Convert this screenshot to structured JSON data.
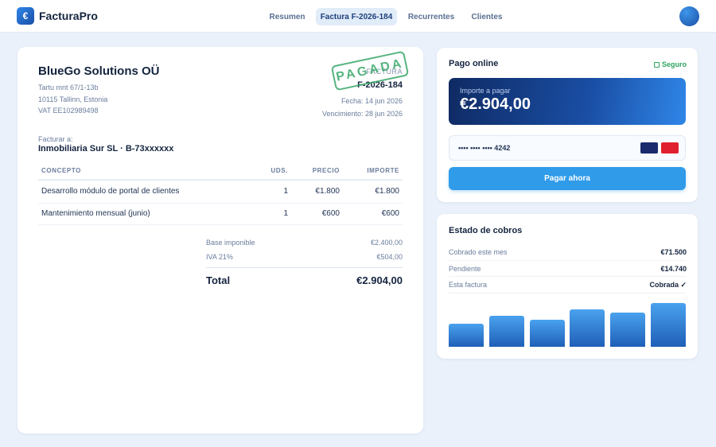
{
  "app": {
    "name": "FacturaPro",
    "logo_glyph": "€"
  },
  "nav": {
    "items": [
      {
        "label": "Resumen"
      },
      {
        "label": "Factura F-2026-184"
      },
      {
        "label": "Recurrentes"
      },
      {
        "label": "Clientes"
      }
    ],
    "active_index": 1
  },
  "invoice": {
    "company": "BlueGo Solutions OÜ",
    "address": [
      "Tartu mnt 67/1-13b",
      "10115 Tallinn, Estonia",
      "VAT EE102989498"
    ],
    "stamp": "PAGADA",
    "doc_label": "FACTURA",
    "number": "F-2026-184",
    "date": "Fecha: 14 jun 2026",
    "due": "Vencimiento: 28 jun 2026",
    "bill_to_label": "Facturar a:",
    "bill_to": "Inmobiliaria Sur SL · B-73xxxxxx",
    "columns": [
      "CONCEPTO",
      "UDS.",
      "PRECIO",
      "IMPORTE"
    ],
    "rows": [
      {
        "concept": "Desarrollo módulo de portal de clientes",
        "units": "1",
        "price": "€1.800",
        "amount": "€1.800"
      },
      {
        "concept": "Mantenimiento mensual (junio)",
        "units": "1",
        "price": "€600",
        "amount": "€600"
      }
    ],
    "subtotal_label": "Base imponible",
    "subtotal": "€2.400,00",
    "tax_label": "IVA 21%",
    "tax": "€504,00",
    "total_label": "Total",
    "total": "€2.904,00",
    "stamp_color": "#3aa86a"
  },
  "payment": {
    "title": "Pago online",
    "secure_label": "Seguro",
    "amount_label": "Importe a pagar",
    "amount": "€2.904,00",
    "card_number": "•••• •••• •••• 4242",
    "card_brand_colors": [
      "#1a2a6c",
      "#e0202e"
    ],
    "pay_button": "Pagar ahora",
    "accent": "#2f9be9"
  },
  "collections": {
    "title": "Estado de cobros",
    "stats": [
      {
        "label": "Cobrado este mes",
        "value": "€71.500"
      },
      {
        "label": "Pendiente",
        "value": "€14.740"
      },
      {
        "label": "Esta factura",
        "value": "Cobrada ✓"
      }
    ],
    "chart_bars": [
      0.51,
      0.69,
      0.61,
      0.84,
      0.76,
      0.99
    ]
  }
}
